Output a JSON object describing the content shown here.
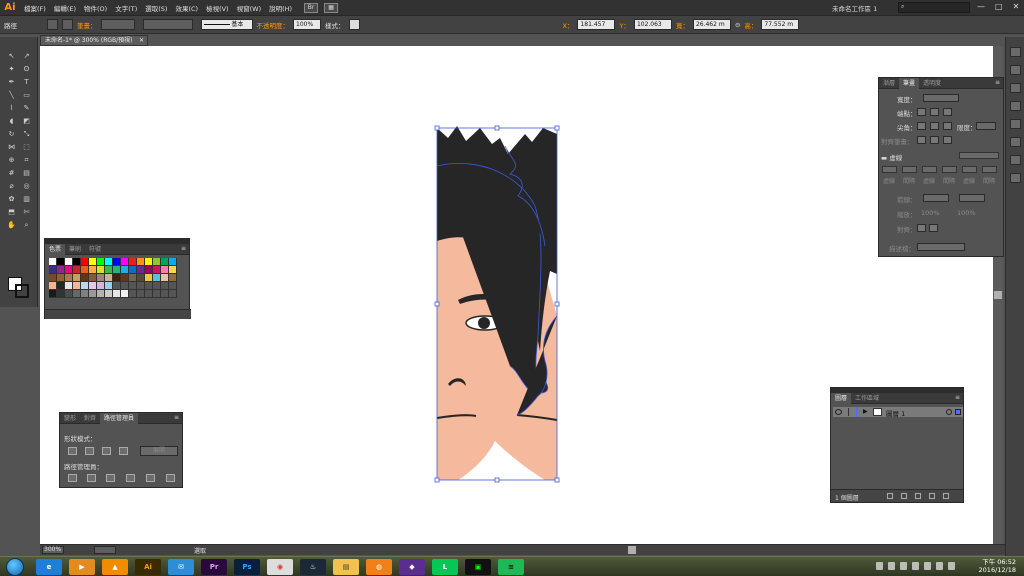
{
  "app": {
    "logo": "Ai",
    "menus": [
      "檔案(F)",
      "編輯(E)",
      "物件(O)",
      "文字(T)",
      "選取(S)",
      "效果(C)",
      "檢視(V)",
      "視窗(W)",
      "說明(H)"
    ],
    "workspace": "未命名工作區 1",
    "search_placeholder": "",
    "window_buttons": [
      "—",
      "□",
      "✕"
    ]
  },
  "control": {
    "mode": "路徑",
    "stroke_label": "筆畫：",
    "profile": "基本",
    "opacity_label": "不透明度：",
    "opacity": "100%",
    "style_label": "樣式：",
    "x_label": "X：",
    "x": "181.457",
    "y_label": "Y：",
    "y": "102.063",
    "w_label": "寬：",
    "w": "26.462 m",
    "h_label": "高：",
    "h": "77.552 m"
  },
  "document": {
    "tab": "未命名-1* @ 300% (RGB/預視)",
    "close": "✕"
  },
  "swatches": {
    "tabs": [
      "色票",
      "筆刷",
      "符號"
    ],
    "active": 0,
    "colors": [
      [
        "#ffffff",
        "#000000",
        "#ffffff",
        "#000000",
        "#ff0000",
        "#ffff00",
        "#00ff00",
        "#00ffff",
        "#0000ff",
        "#ff00ff",
        "#ed1c24",
        "#f7941d",
        "#fff200",
        "#8dc63f",
        "#00a651",
        "#00aeef"
      ],
      [
        "#2e3192",
        "#92278f",
        "#ec008c",
        "#c1272d",
        "#f15a24",
        "#fbb03b",
        "#d9e021",
        "#39b54a",
        "#22b573",
        "#29abe2",
        "#0071bc",
        "#662d91",
        "#9e005d",
        "#d4145a",
        "#ff7bac",
        "#ffd54f"
      ],
      [
        "#754c24",
        "#8c6239",
        "#a67c52",
        "#c69c6d",
        "#603813",
        "#7d5b3f",
        "#998675",
        "#c7b299",
        "#42210b",
        "#5e3a1d",
        "#736357",
        "#534741",
        "#f0c34b",
        "#5bc0de",
        "#e7c6a5",
        "#8a6d3b"
      ],
      [
        "#f5b499",
        "#262626",
        "#e6e6e6",
        "#f5b499",
        "#b8d8ef",
        "#e3c9e8",
        "#d8b4dd",
        "#9ad0ec",
        "#555555",
        "#555555",
        "#555555",
        "#555555",
        "#555555",
        "#555555",
        "#555555",
        "#555555"
      ],
      [
        "#1a1a1a",
        "#333333",
        "#4d4d4d",
        "#666666",
        "#808080",
        "#999999",
        "#b3b3b3",
        "#cccccc",
        "#e6e6e6",
        "#f2f2f2",
        "#555555",
        "#555555",
        "#555555",
        "#555555",
        "#555555",
        "#555555"
      ]
    ]
  },
  "pathfinder": {
    "tabs": [
      "變形",
      "對齊",
      "路徑管理員"
    ],
    "active": 2,
    "shape_modes_label": "形狀模式：",
    "pathfinders_label": "路徑管理員：",
    "expand_label": "展開"
  },
  "stroke": {
    "tabs": [
      "漸層",
      "筆畫",
      "透明度"
    ],
    "active": 1,
    "weight_label": "寬度：",
    "cap_label": "端點：",
    "corner_label": "尖角：",
    "limit_label": "限度：",
    "align_label": "對齊筆畫：",
    "dashed_label": "虛線",
    "dash_labels": [
      "虛線",
      "間隔",
      "虛線",
      "間隔",
      "虛線",
      "間隔"
    ],
    "arrow_label": "箭頭：",
    "scale_label": "縮放：",
    "scale_a": "100%",
    "scale_b": "100%",
    "align2_label": "對齊：",
    "profile_label": "描述檔："
  },
  "layers": {
    "tabs": [
      "圖層",
      "工作區域"
    ],
    "active": 0,
    "rows": [
      {
        "name": "圖層 1"
      }
    ],
    "count": "1 個圖層",
    "highlight": "#4c6fff"
  },
  "status": {
    "zoom": "300%",
    "mode": "選取"
  },
  "taskbar": {
    "apps": [
      "IE",
      "WMP",
      "VLC",
      "Ai",
      "Mail",
      "Pr",
      "Ps",
      "Chrome",
      "Steam",
      "Explorer",
      "Firefox",
      "VS",
      "LINE",
      "Terminal",
      "Spotify"
    ],
    "time": "下午 06:52",
    "date": "2016/12/18"
  },
  "art": {
    "hair": "#262626",
    "skin": "#f5b99e",
    "path": "#3c5adb"
  }
}
